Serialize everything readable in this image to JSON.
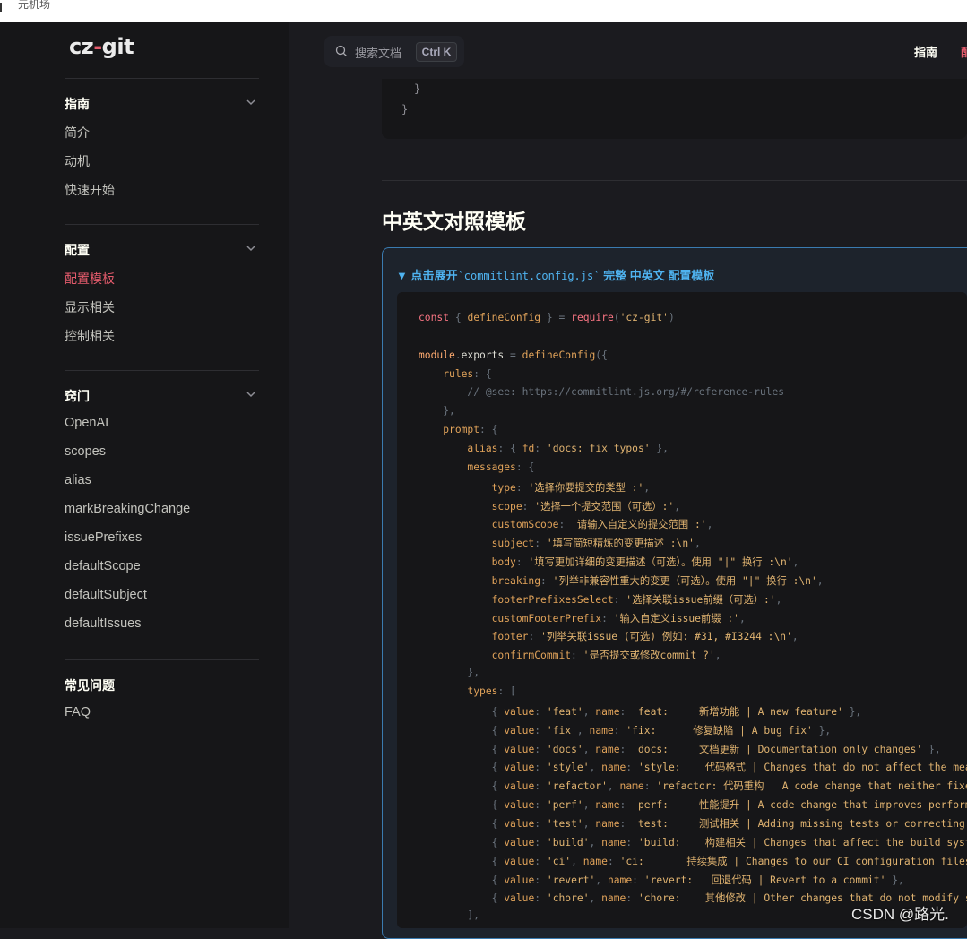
{
  "window": {
    "title": "一元机场"
  },
  "logo": {
    "text_a": "cz",
    "text_z": "-",
    "text_b": "git"
  },
  "sidebar": {
    "groups": [
      {
        "title": "指南",
        "items": [
          "简介",
          "动机",
          "快速开始"
        ]
      },
      {
        "title": "配置",
        "items": [
          "配置模板",
          "显示相关",
          "控制相关"
        ]
      },
      {
        "title": "窍门",
        "items": [
          "OpenAI",
          "scopes",
          "alias",
          "markBreakingChange",
          "issuePrefixes",
          "defaultScope",
          "defaultSubject",
          "defaultIssues"
        ]
      },
      {
        "title": "常见问题",
        "items": [
          "FAQ"
        ]
      }
    ],
    "active_item": "配置模板"
  },
  "search": {
    "placeholder": "搜索文档",
    "shortcut": "Ctrl K"
  },
  "nav": {
    "guide": "指南",
    "next_cut": "配"
  },
  "prev_code": {
    "line1": "  }",
    "line2": "}"
  },
  "content": {
    "heading": "中英文对照模板",
    "summary": {
      "arrow": "▼",
      "prefix": "点击展开",
      "code": "`commitlint.config.js`",
      "suffix": "完整 中英文 配置模板"
    },
    "code_lines": [
      "const { defineConfig } = require('cz-git')",
      "",
      "module.exports = defineConfig({",
      "    rules: {",
      "        // @see: https://commitlint.js.org/#/reference-rules",
      "    },",
      "    prompt: {",
      "        alias: { fd: 'docs: fix typos' },",
      "        messages: {",
      "            type: '选择你要提交的类型 :',",
      "            scope: '选择一个提交范围（可选）:',",
      "            customScope: '请输入自定义的提交范围 :',",
      "            subject: '填写简短精炼的变更描述 :\\n',",
      "            body: '填写更加详细的变更描述（可选）。使用 \"|\" 换行 :\\n',",
      "            breaking: '列举非兼容性重大的变更（可选）。使用 \"|\" 换行 :\\n',",
      "            footerPrefixesSelect: '选择关联issue前缀（可选）:',",
      "            customFooterPrefix: '输入自定义issue前缀 :',",
      "            footer: '列举关联issue (可选) 例如: #31, #I3244 :\\n',",
      "            confirmCommit: '是否提交或修改commit ?',",
      "        },",
      "        types: [",
      "            { value: 'feat', name: 'feat:     新增功能 | A new feature' },",
      "            { value: 'fix', name: 'fix:      修复缺陷 | A bug fix' },",
      "            { value: 'docs', name: 'docs:     文档更新 | Documentation only changes' },",
      "            { value: 'style', name: 'style:    代码格式 | Changes that do not affect the meaning of the code' },",
      "            { value: 'refactor', name: 'refactor: 代码重构 | A code change that neither fixes a bug nor adds a feature' },",
      "            { value: 'perf', name: 'perf:     性能提升 | A code change that improves performance' },",
      "            { value: 'test', name: 'test:     测试相关 | Adding missing tests or correcting existing tests' },",
      "            { value: 'build', name: 'build:    构建相关 | Changes that affect the build system or external dependencies' },",
      "            { value: 'ci', name: 'ci:       持续集成 | Changes to our CI configuration files and scripts' },",
      "            { value: 'revert', name: 'revert:   回退代码 | Revert to a commit' },",
      "            { value: 'chore', name: 'chore:    其他修改 | Other changes that do not modify src or test files' },",
      "        ],"
    ]
  },
  "watermark": "CSDN @路光."
}
